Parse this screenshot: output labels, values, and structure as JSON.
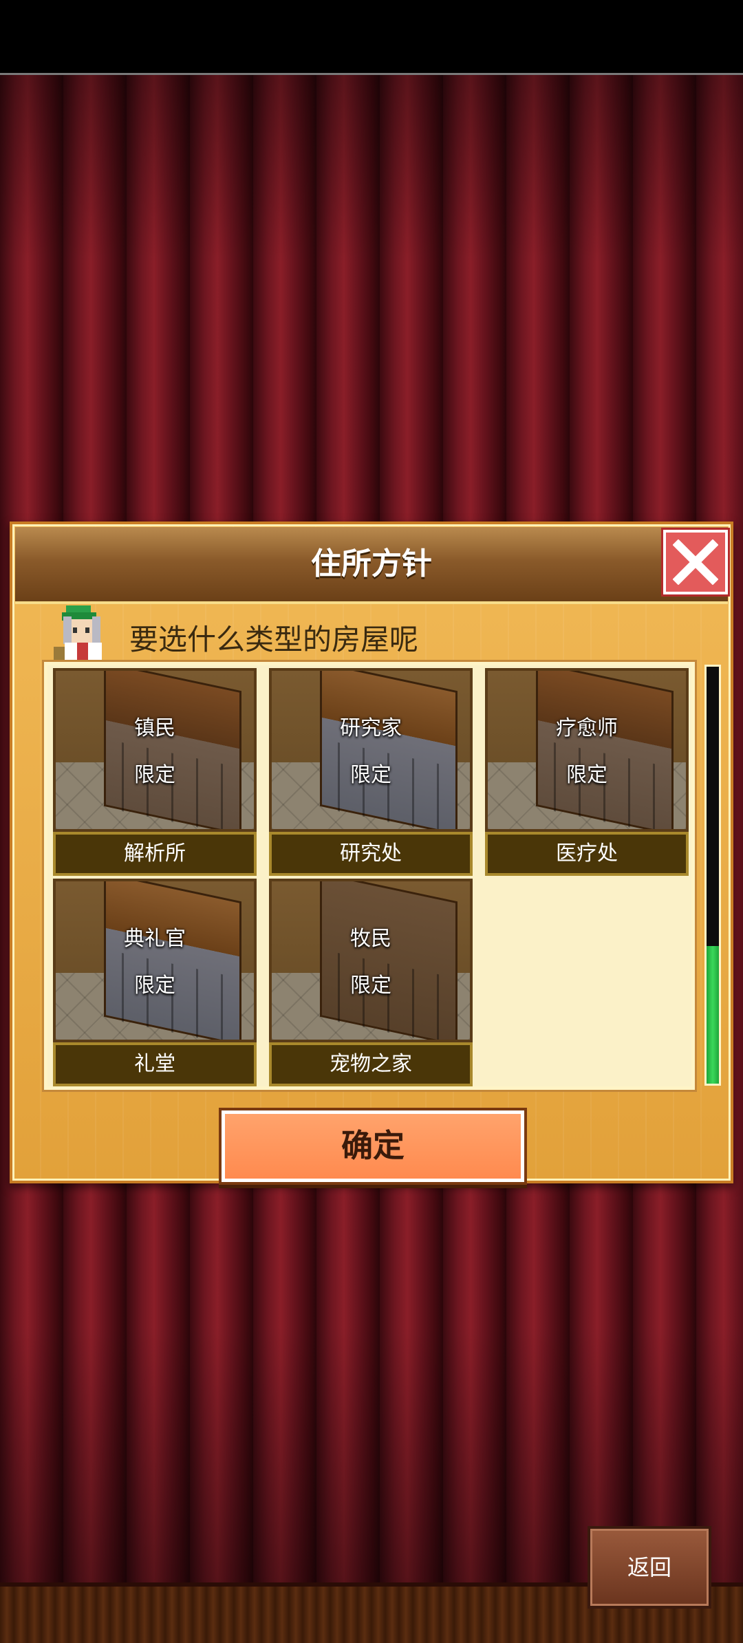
{
  "dialog": {
    "title": "住所方针",
    "prompt": "要选什么类型的房屋呢",
    "confirm_label": "确定"
  },
  "tiles": [
    {
      "role": "镇民",
      "limited": "限定",
      "label": "解析所"
    },
    {
      "role": "研究家",
      "limited": "限定",
      "label": "研究处"
    },
    {
      "role": "疗愈师",
      "limited": "限定",
      "label": "医疗处"
    },
    {
      "role": "典礼官",
      "limited": "限定",
      "label": "礼堂"
    },
    {
      "role": "牧民",
      "limited": "限定",
      "label": "宠物之家"
    }
  ],
  "scroll": {
    "position_fraction": 0.33
  },
  "footer": {
    "back_label": "返回"
  },
  "colors": {
    "accent_orange": "#ff8a4f",
    "header_brown": "#8a5a2a",
    "close_red": "#e35b5b",
    "scroll_green": "#3ad85a"
  },
  "icons": [
    "close-icon",
    "advisor-avatar-icon"
  ]
}
